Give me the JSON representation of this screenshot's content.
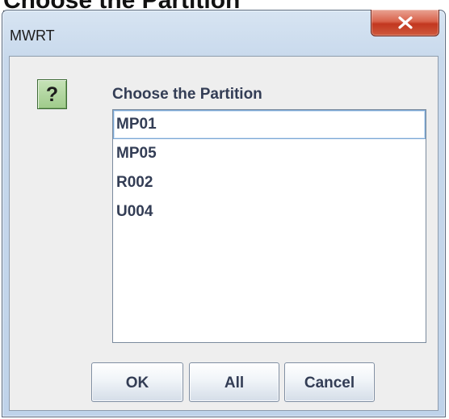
{
  "heading": "Choose the Partition",
  "window": {
    "title": "MWRT",
    "close_icon": "close-x-icon"
  },
  "dialog": {
    "icon": "question-icon",
    "icon_glyph": "?",
    "prompt": "Choose the Partition",
    "partitions": [
      "MP01",
      "MP05",
      "R002",
      "U004"
    ],
    "focused_item": "MP01",
    "buttons": {
      "ok": "OK",
      "all": "All",
      "cancel": "Cancel"
    }
  },
  "colors": {
    "text": "#333d55",
    "close_button": "#c2371f",
    "icon_green": "#9fcb8a",
    "focus_border": "#7ba7d4"
  }
}
